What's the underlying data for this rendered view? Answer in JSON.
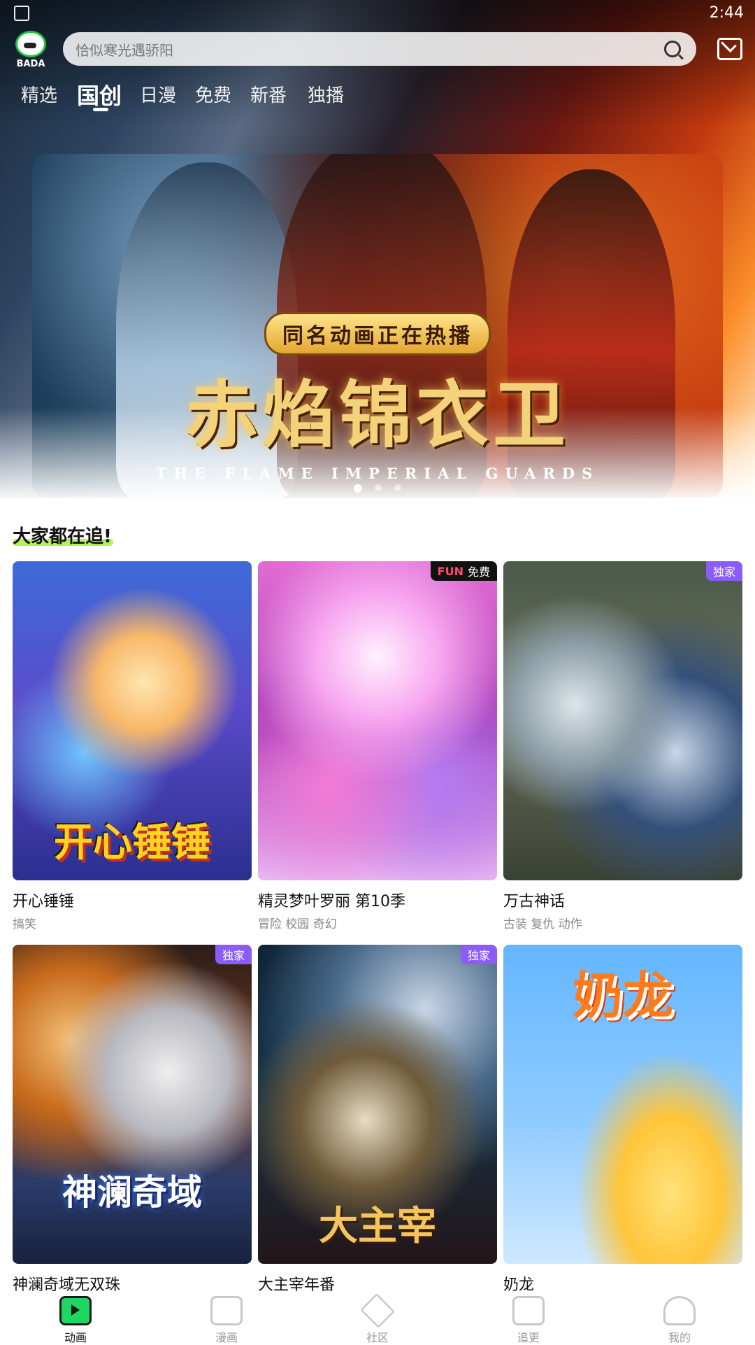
{
  "status_bar": {
    "time": "2:44"
  },
  "header": {
    "logo_text": "BADA",
    "search_placeholder": "恰似寒光遇骄阳"
  },
  "tabs": [
    {
      "label": "精选",
      "active": false
    },
    {
      "label": "国创",
      "active": true
    },
    {
      "label": "日漫",
      "active": false
    },
    {
      "label": "免费",
      "active": false
    },
    {
      "label": "新番",
      "active": false
    },
    {
      "label": "独播",
      "active": false
    }
  ],
  "banner": {
    "tagline": "同名动画正在热播",
    "title": "赤焰锦衣卫",
    "subtitle": "THE FLAME IMPERIAL GUARDS",
    "page_count": 3,
    "active_page": 1
  },
  "section": {
    "title": "大家都在追!",
    "cards": [
      {
        "title": "开心锤锤",
        "tags": "搞笑",
        "badge": "",
        "poster_text": "开心锤锤"
      },
      {
        "title": "精灵梦叶罗丽 第10季",
        "tags": "冒险  校园  奇幻",
        "badge": "免费",
        "badge_brand": "FUN",
        "poster_text": ""
      },
      {
        "title": "万古神话",
        "tags": "古装  复仇  动作",
        "badge": "独家",
        "poster_text": ""
      },
      {
        "title": "神澜奇域无双珠",
        "tags": "",
        "badge": "独家",
        "poster_text": "神澜奇域"
      },
      {
        "title": "大主宰年番",
        "tags": "",
        "badge": "独家",
        "poster_text": "大主宰"
      },
      {
        "title": "奶龙",
        "tags": "",
        "badge": "",
        "poster_text": "奶龙"
      }
    ]
  },
  "bottom_nav": [
    {
      "label": "动画",
      "active": true,
      "icon": "tv-play-icon"
    },
    {
      "label": "漫画",
      "active": false,
      "icon": "comic-icon"
    },
    {
      "label": "社区",
      "active": false,
      "icon": "community-icon"
    },
    {
      "label": "追更",
      "active": false,
      "icon": "follow-box-icon"
    },
    {
      "label": "我的",
      "active": false,
      "icon": "profile-icon"
    }
  ]
}
